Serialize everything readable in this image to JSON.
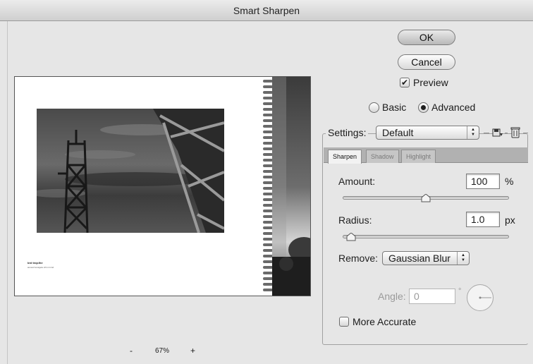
{
  "window": {
    "title": "Smart Sharpen"
  },
  "buttons": {
    "ok": "OK",
    "cancel": "Cancel"
  },
  "preview_toggle": {
    "label": "Preview",
    "checked": true
  },
  "mode": {
    "options": [
      "Basic",
      "Advanced"
    ],
    "selected": "Advanced"
  },
  "settings": {
    "label": "Settings:",
    "selected": "Default",
    "save_icon": "save-settings-icon",
    "delete_icon": "trash-icon"
  },
  "tabs": [
    {
      "label": "Sharpen",
      "active": true
    },
    {
      "label": "Shadow",
      "active": false
    },
    {
      "label": "Highlight",
      "active": false
    }
  ],
  "sharpen": {
    "amount": {
      "label": "Amount:",
      "value": "100",
      "unit": "%",
      "slider_fraction": 0.5
    },
    "radius": {
      "label": "Radius:",
      "value": "1.0",
      "unit": "px",
      "slider_fraction": 0.05
    },
    "remove": {
      "label": "Remove:",
      "selected": "Gaussian Blur"
    },
    "angle": {
      "label": "Angle:",
      "value": "0",
      "unit": "°",
      "enabled": false
    },
    "more_accurate": {
      "label": "More Accurate",
      "checked": false
    }
  },
  "zoom": {
    "minus": "-",
    "value": "67%",
    "plus": "+"
  },
  "preview_caption": {
    "title": "brd teqclhe",
    "text": "ancest heruigetu ichn rnnnd"
  },
  "colors": {
    "sky": "#5a5a5a",
    "tower": "#2a2a2a",
    "paper": "#ffffff"
  }
}
